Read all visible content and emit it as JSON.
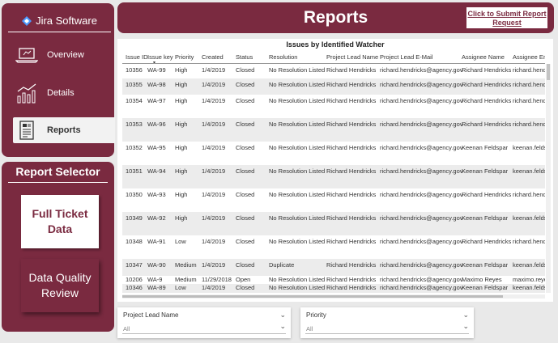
{
  "nav": {
    "logo_text": "Jira Software",
    "items": [
      {
        "label": "Overview",
        "icon": "laptop-icon"
      },
      {
        "label": "Details",
        "icon": "line-chart-icon"
      },
      {
        "label": "Reports",
        "icon": "report-document-icon"
      }
    ]
  },
  "selector": {
    "title": "Report Selector",
    "options": [
      "Full Ticket Data",
      "Data Quality Review"
    ]
  },
  "header": {
    "title": "Reports",
    "submit_link": "Click to Submit Report Request"
  },
  "table": {
    "title": "Issues by Identified Watcher",
    "columns": [
      "Issue ID",
      "Issue key",
      "Priority",
      "Created",
      "Status",
      "Resolution",
      "Project Lead Name",
      "Project Lead E-Mail",
      "Assignee Name",
      "Assignee Em"
    ],
    "rows": [
      [
        "10356",
        "WA-99",
        "High",
        "1/4/2019",
        "Closed",
        "No Resolution Listed",
        "Richard Hendricks",
        "richard.hendricks@agency.gov",
        "Richard Hendricks",
        "richard.hend"
      ],
      [
        "10355",
        "WA-98",
        "High",
        "1/4/2019",
        "Closed",
        "No Resolution Listed",
        "Richard Hendricks",
        "richard.hendricks@agency.gov",
        "Richard Hendricks",
        "richard.hend"
      ],
      [
        "10354",
        "WA-97",
        "High",
        "1/4/2019",
        "Closed",
        "No Resolution Listed",
        "Richard Hendricks",
        "richard.hendricks@agency.gov",
        "Richard Hendricks",
        "richard.hend"
      ],
      [
        "10353",
        "WA-96",
        "High",
        "1/4/2019",
        "Closed",
        "No Resolution Listed",
        "Richard Hendricks",
        "richard.hendricks@agency.gov",
        "Richard Hendricks",
        "richard.hend"
      ],
      [
        "10352",
        "WA-95",
        "High",
        "1/4/2019",
        "Closed",
        "No Resolution Listed",
        "Richard Hendricks",
        "richard.hendricks@agency.gov",
        "Keenan Feldspar",
        "keenan.felds"
      ],
      [
        "10351",
        "WA-94",
        "High",
        "1/4/2019",
        "Closed",
        "No Resolution Listed",
        "Richard Hendricks",
        "richard.hendricks@agency.gov",
        "Keenan Feldspar",
        "keenan.felds"
      ],
      [
        "10350",
        "WA-93",
        "High",
        "1/4/2019",
        "Closed",
        "No Resolution Listed",
        "Richard Hendricks",
        "richard.hendricks@agency.gov",
        "Richard Hendricks",
        "richard.hend"
      ],
      [
        "10349",
        "WA-92",
        "High",
        "1/4/2019",
        "Closed",
        "No Resolution Listed",
        "Richard Hendricks",
        "richard.hendricks@agency.gov",
        "Keenan Feldspar",
        "keenan.felds"
      ],
      [
        "10348",
        "WA-91",
        "Low",
        "1/4/2019",
        "Closed",
        "No Resolution Listed",
        "Richard Hendricks",
        "richard.hendricks@agency.gov",
        "Richard Hendricks",
        "richard.hend"
      ],
      [
        "10347",
        "WA-90",
        "Medium",
        "1/4/2019",
        "Closed",
        "Duplicate",
        "Richard Hendricks",
        "richard.hendricks@agency.gov",
        "Keenan Feldspar",
        "keenan.felds"
      ],
      [
        "10206",
        "WA-9",
        "Medium",
        "11/29/2018",
        "Open",
        "No Resolution Listed",
        "Richard Hendricks",
        "richard.hendricks@agency.gov",
        "Maximo Reyes",
        "maximo.reye"
      ],
      [
        "10346",
        "WA-89",
        "Low",
        "1/4/2019",
        "Closed",
        "No Resolution Listed",
        "Richard Hendricks",
        "richard.hendricks@agency.gov",
        "Keenan Feldspar",
        "keenan.felds"
      ]
    ]
  },
  "filters": [
    {
      "label": "Project Lead Name",
      "value": "All"
    },
    {
      "label": "Priority",
      "value": "All"
    }
  ],
  "colors": {
    "brand": "#7a2a40",
    "background": "#e9e9e9",
    "row_alt": "#ececec"
  }
}
